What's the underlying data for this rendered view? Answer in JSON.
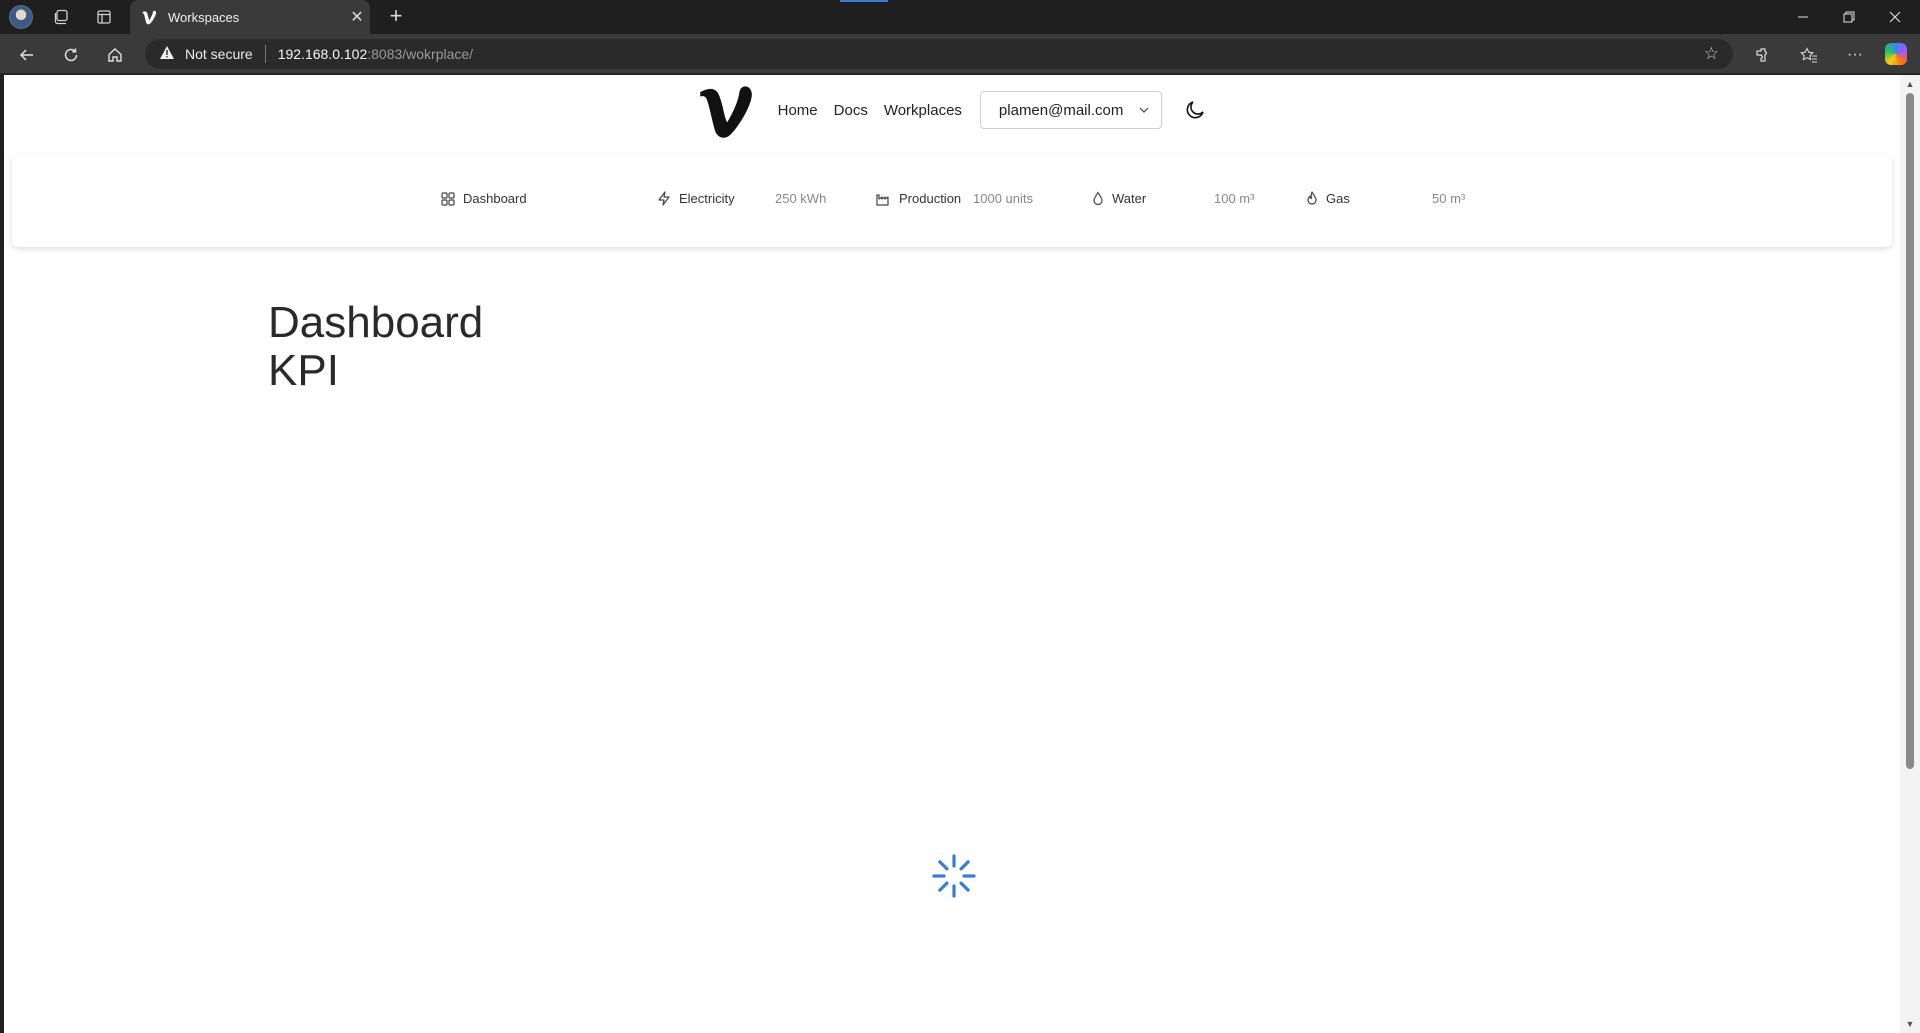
{
  "browser": {
    "tab_title": "Workspaces",
    "security_label": "Not secure",
    "url_host": "192.168.0.102",
    "url_rest": ":8083/wokrplace/"
  },
  "header": {
    "nav": [
      "Home",
      "Docs",
      "Workplaces"
    ],
    "user_email": "plamen@mail.com"
  },
  "kpis": [
    {
      "label": "Dashboard",
      "value": "",
      "icon": "grid-icon"
    },
    {
      "label": "Electricity",
      "value": "250 kWh",
      "icon": "bolt-icon"
    },
    {
      "label": "Production",
      "value": "1000 units",
      "icon": "factory-icon"
    },
    {
      "label": "Water",
      "value": "100 m³",
      "icon": "droplet-icon"
    },
    {
      "label": "Gas",
      "value": "50 m³",
      "icon": "flame-icon"
    }
  ],
  "page": {
    "title_line1": "Dashboard",
    "title_line2": "KPI"
  },
  "colors": {
    "spinner": "#3a7bd5",
    "tab_active": "#3a3a3a",
    "chrome_bg": "#1f1f1f"
  }
}
